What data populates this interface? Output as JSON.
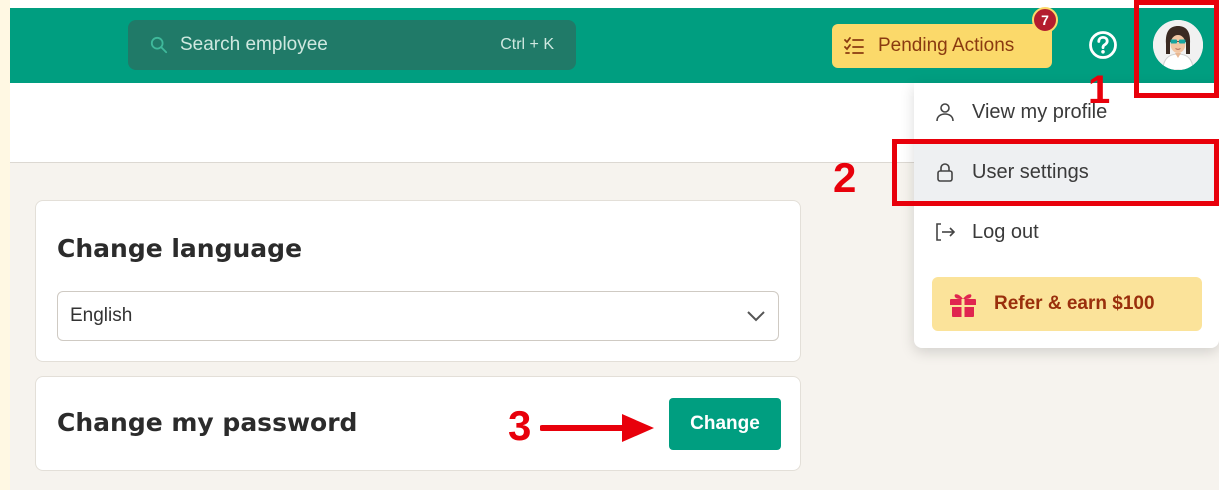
{
  "header": {
    "search": {
      "placeholder": "Search employee",
      "shortcut": "Ctrl + K"
    },
    "pending_actions": {
      "label": "Pending Actions",
      "count": "7"
    },
    "help_icon": "question-circle-icon",
    "avatar": "user-avatar"
  },
  "user_menu": {
    "items": [
      {
        "label": "View my profile",
        "icon": "person-icon"
      },
      {
        "label": "User settings",
        "icon": "lock-icon"
      },
      {
        "label": "Log out",
        "icon": "logout-icon"
      }
    ],
    "refer": {
      "label": "Refer & earn $100",
      "icon": "gift-icon"
    }
  },
  "settings": {
    "language": {
      "title": "Change language",
      "selected": "English"
    },
    "password": {
      "title": "Change my password",
      "button": "Change"
    }
  },
  "annotations": {
    "step1": "1",
    "step2": "2",
    "step3": "3"
  },
  "colors": {
    "brand": "#009e80",
    "pending": "#fbd96a",
    "badge": "#b31d2e",
    "annotation": "#e8000b",
    "refer_bg": "#fbe39a"
  }
}
